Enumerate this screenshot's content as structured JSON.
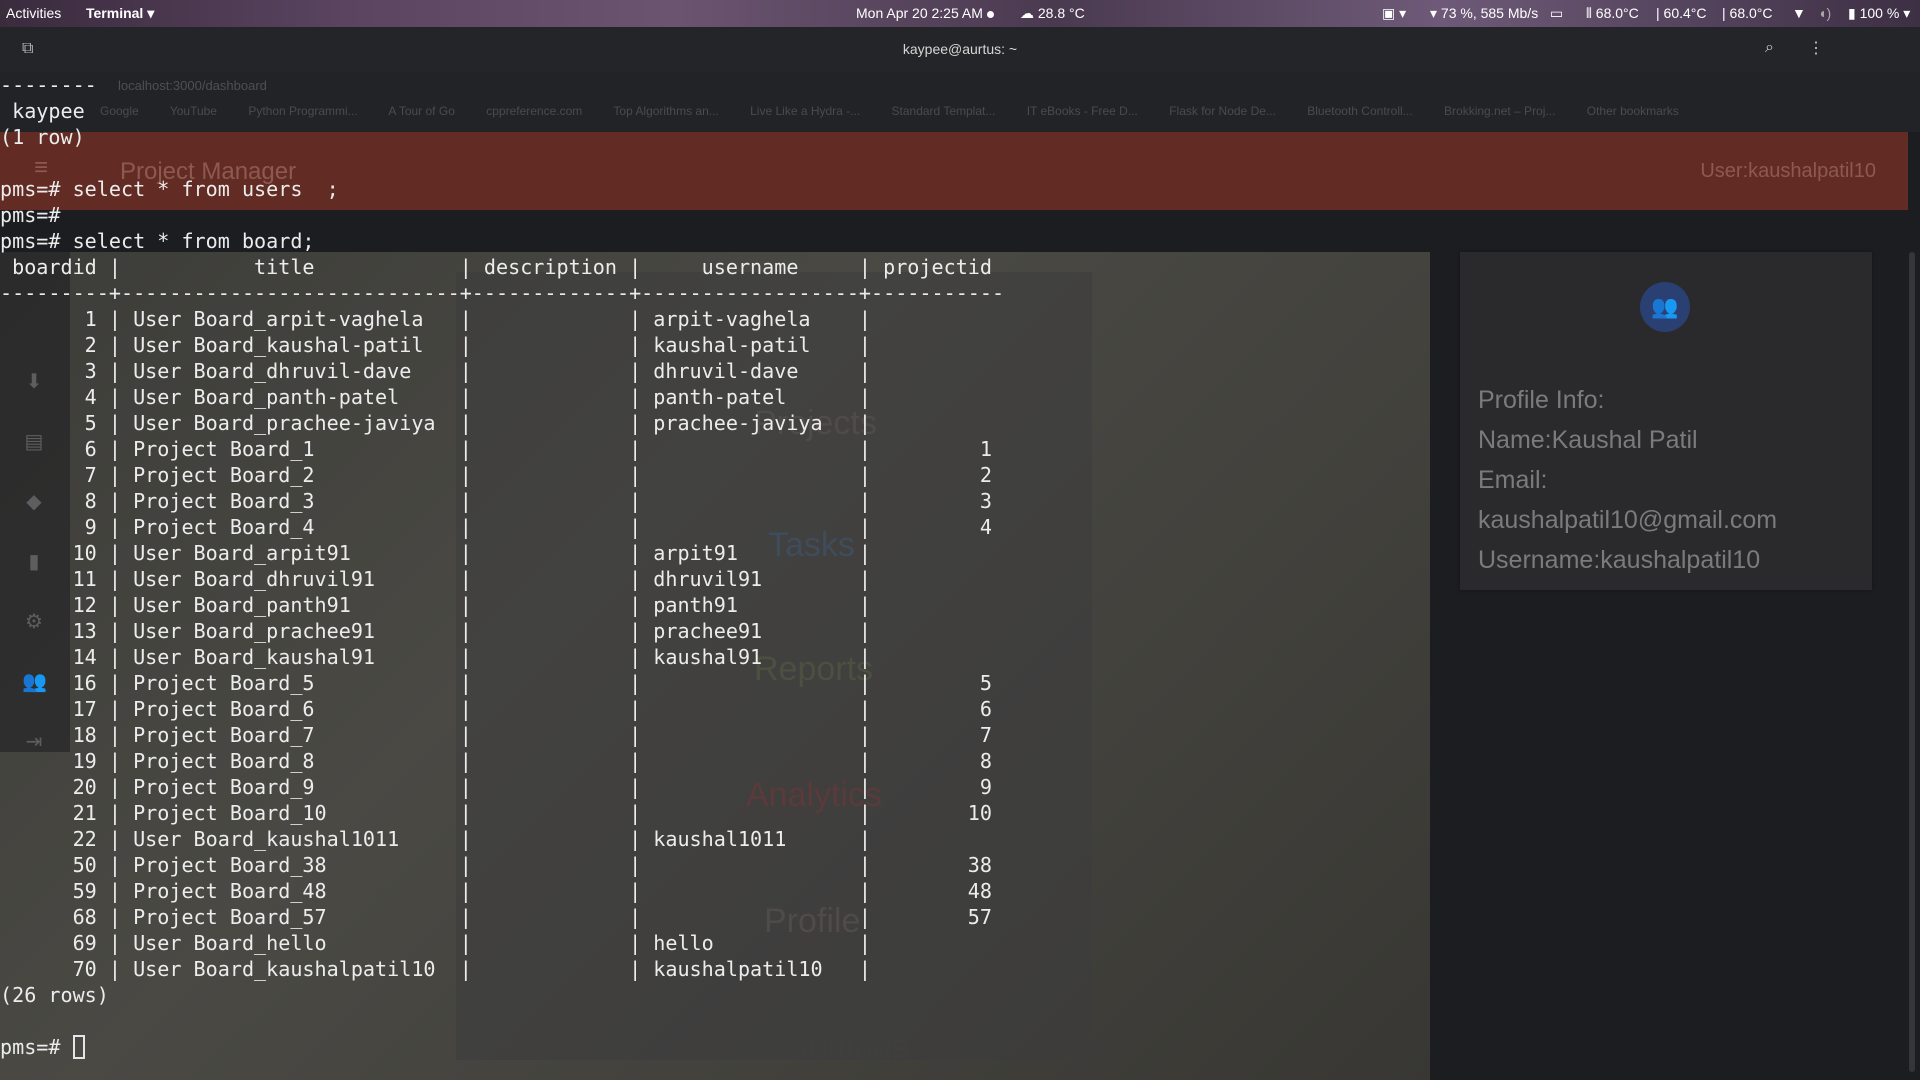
{
  "topbar": {
    "activities": "Activities",
    "app_menu": "Terminal ▾",
    "clock": "Mon Apr 20   2:25 AM",
    "weather": "28.8 °C",
    "network": "73 %, 585 Mb/s",
    "temp1": "68.0°C",
    "temp2": "60.4°C",
    "temp3": "68.0°C",
    "battery": "100 %"
  },
  "terminal": {
    "title": "kaypee@aurtus: ~",
    "prompt": "pms=# ",
    "lines": [
      "--------",
      " kaypee",
      "(1 row)",
      "",
      "pms=# select * from users  ;",
      "pms=#",
      "pms=# select * from board;",
      " boardid |           title            | description |     username     | projectid",
      "---------+----------------------------+-------------+------------------+-----------",
      "       1 | User Board_arpit-vaghela   |             | arpit-vaghela    |",
      "       2 | User Board_kaushal-patil   |             | kaushal-patil    |",
      "       3 | User Board_dhruvil-dave    |             | dhruvil-dave     |",
      "       4 | User Board_panth-patel     |             | panth-patel      |",
      "       5 | User Board_prachee-javiya  |             | prachee-javiya   |",
      "       6 | Project Board_1            |             |                  |         1",
      "       7 | Project Board_2            |             |                  |         2",
      "       8 | Project Board_3            |             |                  |         3",
      "       9 | Project Board_4            |             |                  |         4",
      "      10 | User Board_arpit91         |             | arpit91          |",
      "      11 | User Board_dhruvil91       |             | dhruvil91        |",
      "      12 | User Board_panth91         |             | panth91          |",
      "      13 | User Board_prachee91       |             | prachee91        |",
      "      14 | User Board_kaushal91       |             | kaushal91        |",
      "      16 | Project Board_5            |             |                  |         5",
      "      17 | Project Board_6            |             |                  |         6",
      "      18 | Project Board_7            |             |                  |         7",
      "      19 | Project Board_8            |             |                  |         8",
      "      20 | Project Board_9            |             |                  |         9",
      "      21 | Project Board_10           |             |                  |        10",
      "      22 | User Board_kaushal1011     |             | kaushal1011      |",
      "      50 | Project Board_38           |             |                  |        38",
      "      59 | Project Board_48           |             |                  |        48",
      "      68 | Project Board_57           |             |                  |        57",
      "      69 | User Board_hello           |             | hello            |",
      "      70 | User Board_kaushalpatil10  |             | kaushalpatil10   |",
      "(26 rows)",
      ""
    ]
  },
  "browser": {
    "url": "localhost:3000/dashboard",
    "bookmarks": [
      "Google",
      "YouTube",
      "Python Programmi...",
      "A Tour of Go",
      "cppreference.com",
      "Top Algorithms an...",
      "Live Like a Hydra -...",
      "Standard Templat...",
      "IT eBooks - Free D...",
      "Flask for Node De...",
      "Bluetooth Controll...",
      "Brokking.net – Proj...",
      "Other bookmarks"
    ],
    "app_title": "Project Manager",
    "app_user": "User:kaushalpatil10",
    "menu": [
      "Projects",
      "Tasks",
      "Reports",
      "Analytics",
      "Profile",
      "Settings"
    ],
    "profile": {
      "heading": "Profile Info:",
      "name": "Name:Kaushal Patil",
      "email_label": "Email:",
      "email": "kaushalpatil10@gmail.com",
      "username": "Username:kaushalpatil10"
    }
  },
  "colors": {
    "accent_red": "#622c24",
    "terminal_bg": "#1c1d20",
    "terminal_fg": "#ececec",
    "win_min": "#e6d86a",
    "win_max": "#7fc9c0",
    "win_close": "#e8575a"
  }
}
